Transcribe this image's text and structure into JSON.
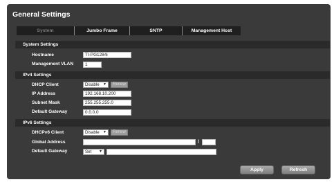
{
  "page": {
    "title": "General Settings"
  },
  "tabs": [
    {
      "label": "System",
      "active": true
    },
    {
      "label": "Jumbo Frame",
      "active": false
    },
    {
      "label": "SNTP",
      "active": false
    },
    {
      "label": "Management Host",
      "active": false
    }
  ],
  "system_settings": {
    "header": "System Settings",
    "hostname_label": "Hostname",
    "hostname_value": "TI-PG1284i",
    "vlan_label": "Management VLAN",
    "vlan_value": "1"
  },
  "ipv4": {
    "header": "IPv4 Settings",
    "dhcp_label": "DHCP Client",
    "dhcp_value": "Disable",
    "renew_label": "Renew",
    "ip_label": "IP Address",
    "ip_value": "192.168.10.200",
    "mask_label": "Subnet Mask",
    "mask_value": "255.255.255.0",
    "gateway_label": "Default Gateway",
    "gateway_value": "0.0.0.0"
  },
  "ipv6": {
    "header": "IPv6 Settings",
    "dhcp_label": "DHCPv6 Client",
    "dhcp_value": "Disable",
    "renew_label": "Renew",
    "global_label": "Global Address",
    "global_value": "",
    "prefix_value": "",
    "separator": "/",
    "gateway_label": "Default Gateway",
    "gateway_select": "Set",
    "gateway_value": ""
  },
  "actions": {
    "apply_label": "Apply",
    "refresh_label": "Refresh"
  },
  "icons": {
    "select_arrow": "▼"
  },
  "colors": {
    "panel": "#3a3a3a",
    "section_header": "#2a2a2a",
    "tab_bar": "#1f1f1f",
    "button": "#8f8f8f"
  }
}
